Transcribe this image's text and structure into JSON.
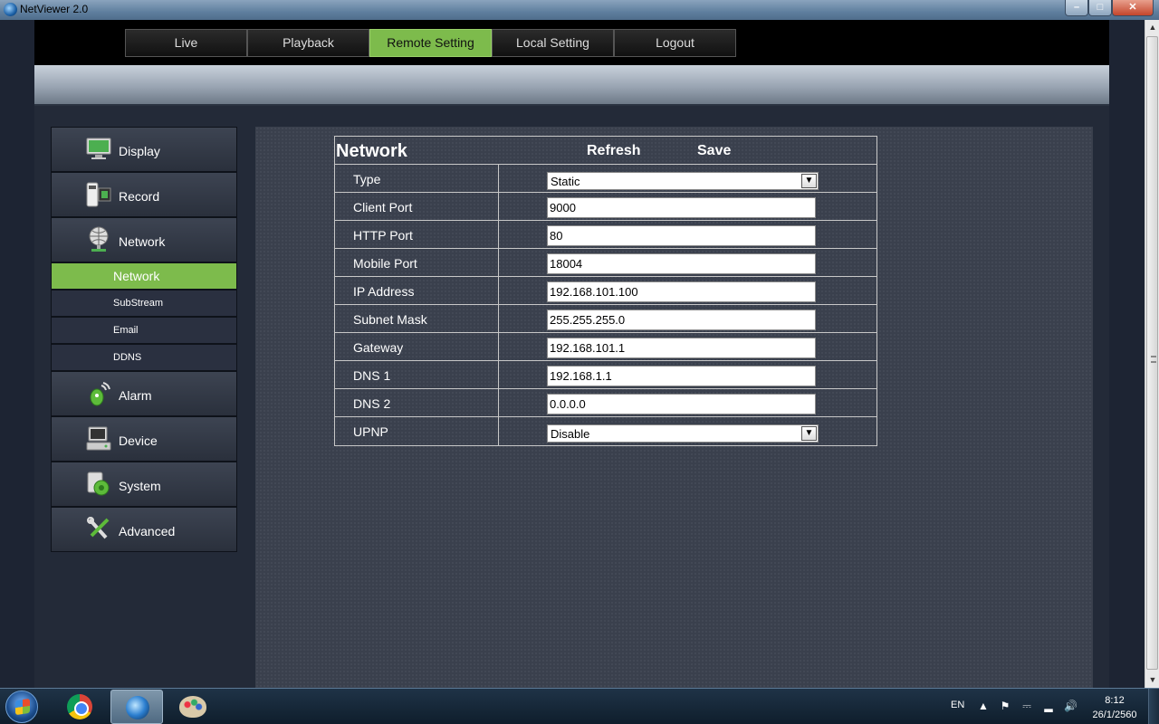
{
  "window": {
    "title": "NetViewer 2.0"
  },
  "nav": {
    "tabs": [
      {
        "label": "Live"
      },
      {
        "label": "Playback"
      },
      {
        "label": "Remote Setting",
        "active": true
      },
      {
        "label": "Local Setting"
      },
      {
        "label": "Logout"
      }
    ]
  },
  "sidebar": {
    "display": "Display",
    "record": "Record",
    "network": "Network",
    "sub": {
      "network": "Network",
      "substream": "SubStream",
      "email": "Email",
      "ddns": "DDNS"
    },
    "alarm": "Alarm",
    "device": "Device",
    "system": "System",
    "advanced": "Advanced"
  },
  "form": {
    "title": "Network",
    "refresh": "Refresh",
    "save": "Save",
    "type": {
      "label": "Type",
      "value": "Static"
    },
    "client_port": {
      "label": "Client Port",
      "value": "9000"
    },
    "http_port": {
      "label": "HTTP Port",
      "value": "80"
    },
    "mobile_port": {
      "label": "Mobile Port",
      "value": "18004"
    },
    "ip_address": {
      "label": "IP Address",
      "value": "192.168.101.100"
    },
    "subnet_mask": {
      "label": "Subnet Mask",
      "value": "255.255.255.0"
    },
    "gateway": {
      "label": "Gateway",
      "value": "192.168.101.1"
    },
    "dns1": {
      "label": "DNS 1",
      "value": "192.168.1.1"
    },
    "dns2": {
      "label": "DNS 2",
      "value": "0.0.0.0"
    },
    "upnp": {
      "label": "UPNP",
      "value": "Disable"
    }
  },
  "taskbar": {
    "language": "EN",
    "time": "8:12",
    "date": "26/1/2560"
  },
  "colors": {
    "accent_green": "#7dbb4c",
    "panel_bg": "#3a404d",
    "page_bg": "#232a38"
  }
}
